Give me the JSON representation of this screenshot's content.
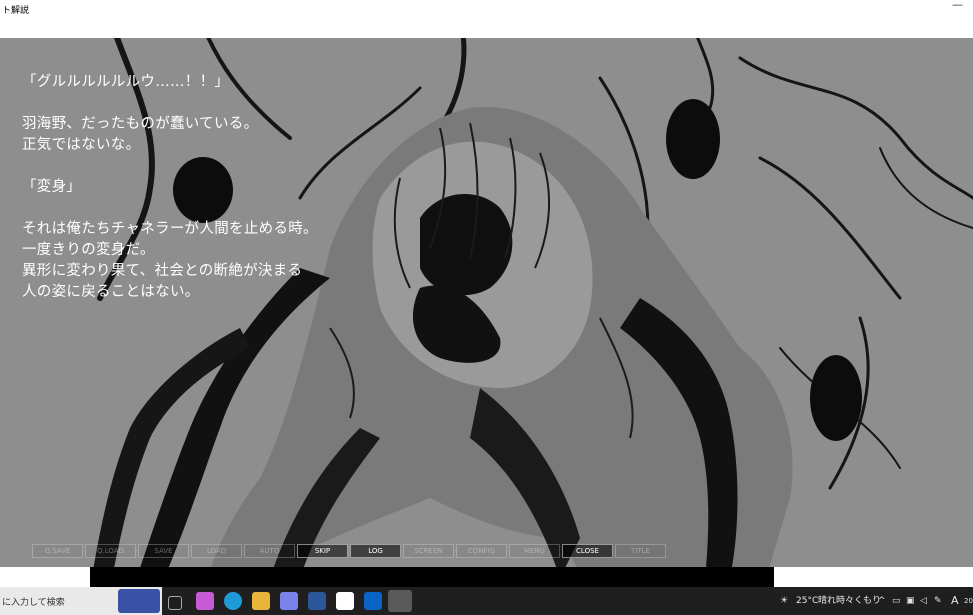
{
  "window": {
    "title": "ト解説",
    "minimize_glyph": "—"
  },
  "dialogue": [
    "「グルルルルルルウ……！！」",
    "",
    "羽海野、だったものが蠢いている。",
    "正気ではないな。",
    "",
    "「変身」",
    "",
    "それは俺たちチャネラーが人間を止める時。",
    "一度きりの変身だ。",
    "異形に変わり果て、社会との断絶が決まる",
    "人の姿に戻ることはない。"
  ],
  "menu": [
    "Q.SAVE",
    "Q.LOAD",
    "SAVE",
    "LOAD",
    "AUTO",
    "SKIP",
    "LOG",
    "SCREEN",
    "CONFIG",
    "MENU",
    "CLOSE",
    "TITLE"
  ],
  "taskbar": {
    "search_placeholder": "に入力して検索",
    "apps": [
      "task-view-icon",
      "copilot-icon",
      "edge-icon",
      "file-explorer-icon",
      "teams-icon",
      "word-icon",
      "onedrive-icon",
      "outlook-icon",
      "game-app-icon"
    ],
    "weather_temp": "25°C",
    "weather_text": "晴れ時々くもり",
    "ime": "A",
    "clock": "20"
  },
  "colors": {
    "game_bg": "#8e8e8e",
    "ink": "#0d0d0d",
    "taskbar": "#1f1f1f"
  }
}
